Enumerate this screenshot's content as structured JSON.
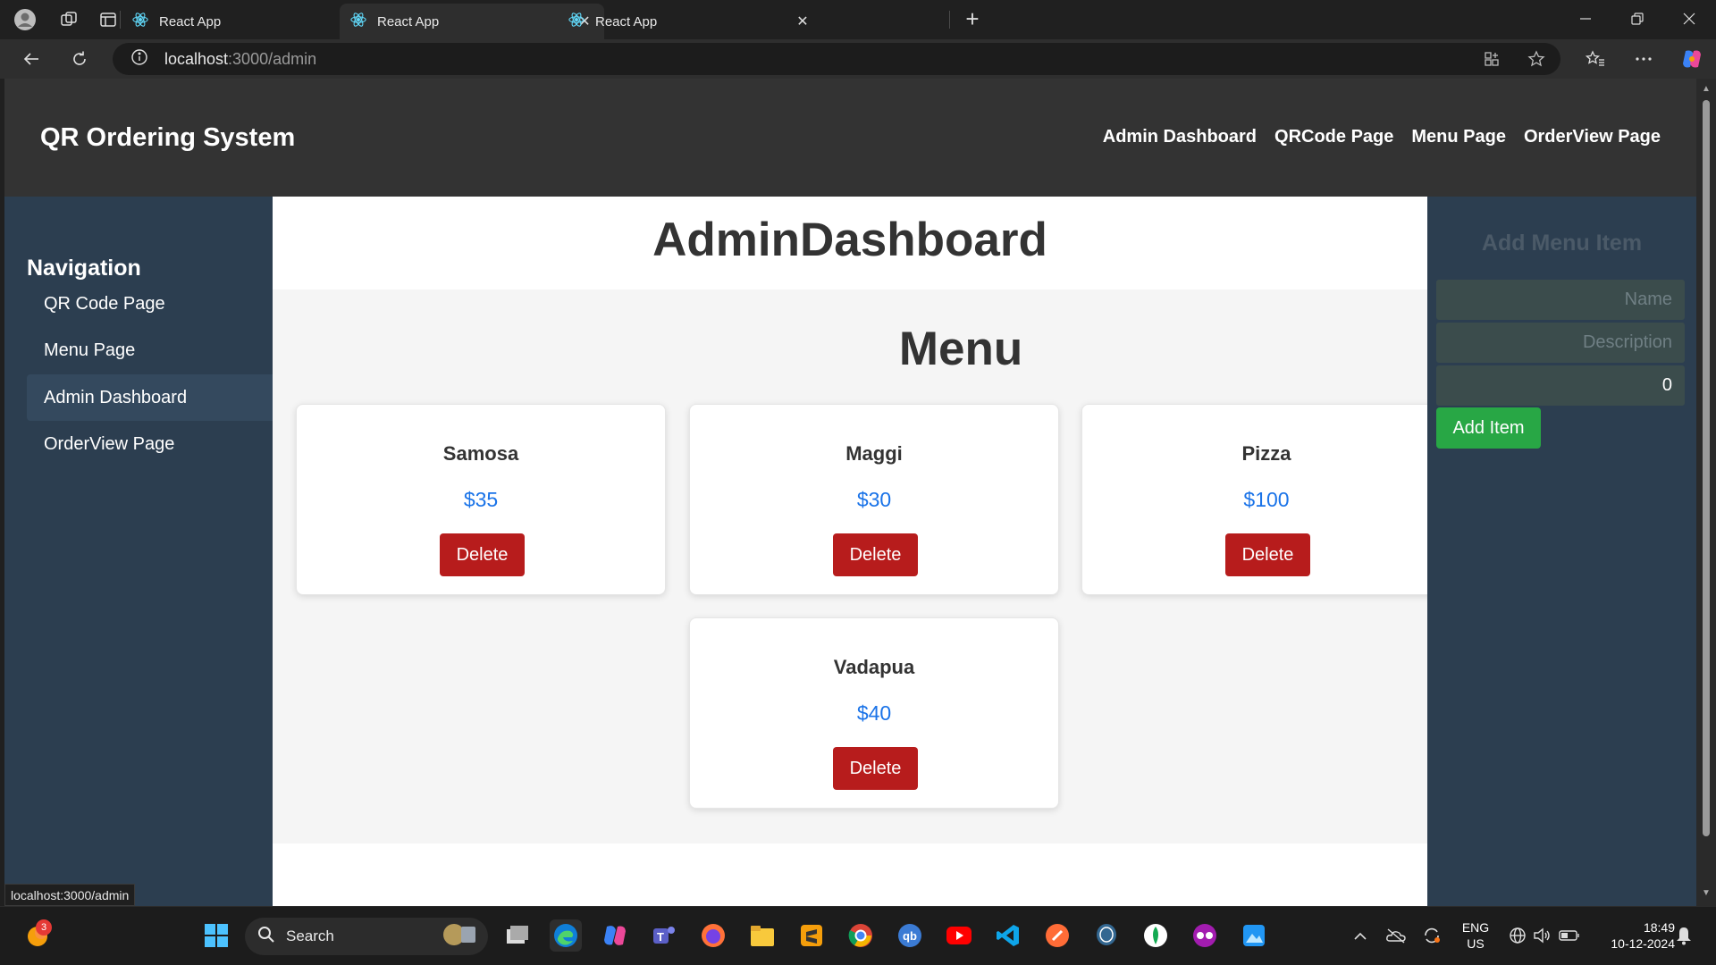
{
  "browser": {
    "tabs": [
      {
        "title": "React App",
        "active": false
      },
      {
        "title": "React App",
        "active": true
      },
      {
        "title": "React App",
        "active": false
      }
    ],
    "url_host": "localhost",
    "url_path": ":3000/admin",
    "status_url": "localhost:3000/admin"
  },
  "header": {
    "title": "QR Ordering System",
    "nav": [
      "Admin Dashboard",
      "QRCode Page",
      "Menu Page",
      "OrderView Page"
    ]
  },
  "sidebar": {
    "title": "Navigation",
    "items": [
      {
        "label": "QR Code Page",
        "active": false
      },
      {
        "label": "Menu Page",
        "active": false
      },
      {
        "label": "Admin Dashboard",
        "active": true
      },
      {
        "label": "OrderView Page",
        "active": false
      }
    ]
  },
  "main": {
    "title": "AdminDashboard",
    "menu_title": "Menu",
    "delete_label": "Delete",
    "items": [
      {
        "name": "Samosa",
        "price": "$35"
      },
      {
        "name": "Maggi",
        "price": "$30"
      },
      {
        "name": "Pizza",
        "price": "$100"
      },
      {
        "name": "Vadapua",
        "price": "$40"
      }
    ]
  },
  "add_panel": {
    "title": "Add Menu Item",
    "name_placeholder": "Name",
    "description_placeholder": "Description",
    "price_value": "0",
    "button_label": "Add Item"
  },
  "taskbar": {
    "search_label": "Search",
    "notification_count": "3",
    "language": "ENG",
    "region": "US",
    "time": "18:49",
    "date": "10-12-2024"
  },
  "colors": {
    "header_bg": "#333333",
    "sidebar_bg": "#2c3e50",
    "delete_button": "#b71c1c",
    "add_button": "#28a745",
    "price_text": "#1a73e8"
  }
}
